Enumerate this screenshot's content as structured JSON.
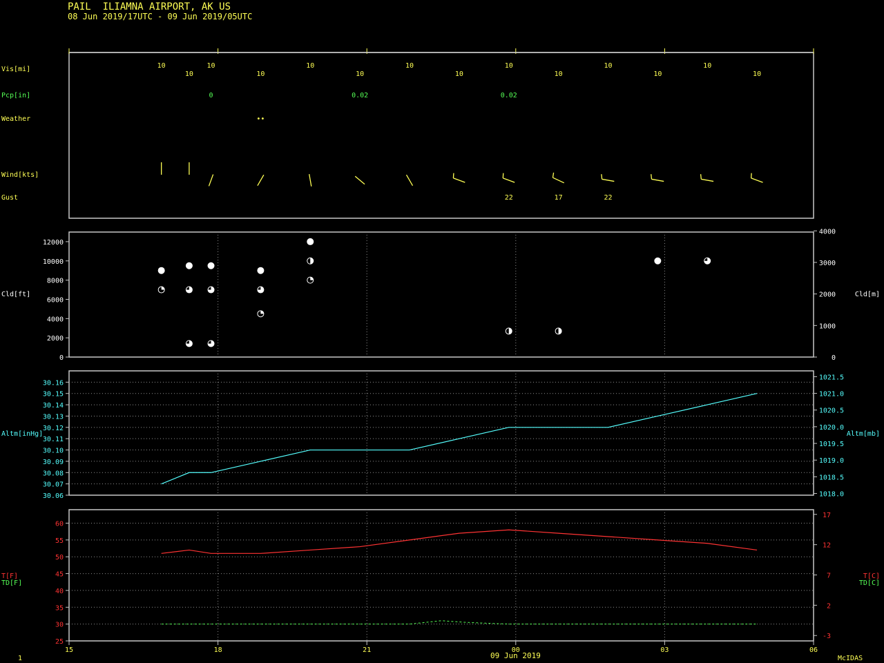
{
  "header": {
    "station": "PAIL",
    "station_name": "ILIAMNA AIRPORT, AK US",
    "period": "08 Jun 2019/17UTC - 09 Jun 2019/05UTC"
  },
  "footer": {
    "date_label": "09 Jun 2019",
    "page_number": "1",
    "software": "McIDAS"
  },
  "colors": {
    "yellow": "#ffff55",
    "green": "#55ff55",
    "cyan": "#55ffff",
    "red": "#ff3333",
    "white": "#ffffff",
    "frame": "#c8c8c8"
  },
  "chart_data": [
    {
      "type": "table",
      "panel": "surface-observations",
      "x_ticks": [
        "15",
        "18",
        "21",
        "00",
        "03",
        "06"
      ],
      "rows": {
        "vis": {
          "label": "Vis[mi]",
          "values": [
            {
              "x": 16.86,
              "v": "10"
            },
            {
              "x": 17.42,
              "v": "10"
            },
            {
              "x": 17.86,
              "v": "10"
            },
            {
              "x": 18.86,
              "v": "10"
            },
            {
              "x": 19.86,
              "v": "10"
            },
            {
              "x": 20.86,
              "v": "10"
            },
            {
              "x": 21.86,
              "v": "10"
            },
            {
              "x": 22.86,
              "v": "10"
            },
            {
              "x": 23.86,
              "v": "10"
            },
            {
              "x": 24.86,
              "v": "10"
            },
            {
              "x": 25.86,
              "v": "10"
            },
            {
              "x": 26.86,
              "v": "10"
            },
            {
              "x": 27.86,
              "v": "10"
            },
            {
              "x": 28.86,
              "v": "10"
            }
          ]
        },
        "pcp": {
          "label": "Pcp[in]",
          "values": [
            {
              "x": 17.86,
              "v": "0"
            },
            {
              "x": 20.86,
              "v": "0.02"
            },
            {
              "x": 23.86,
              "v": "0.02"
            }
          ]
        },
        "weather": {
          "label": "Weather",
          "values": [
            {
              "x": 18.86,
              "v": "••"
            }
          ]
        },
        "wind": {
          "label": "Wind[kts]",
          "barbs": [
            {
              "x": 16.86,
              "dir": 360,
              "speed": 0
            },
            {
              "x": 17.42,
              "dir": 360,
              "speed": 0
            },
            {
              "x": 17.86,
              "dir": 20,
              "speed": 2
            },
            {
              "x": 18.86,
              "dir": 30,
              "speed": 2
            },
            {
              "x": 19.86,
              "dir": 350,
              "speed": 2
            },
            {
              "x": 20.86,
              "dir": 310,
              "speed": 2
            },
            {
              "x": 21.86,
              "dir": 330,
              "speed": 2
            },
            {
              "x": 22.86,
              "dir": 290,
              "speed": 10
            },
            {
              "x": 23.86,
              "dir": 290,
              "speed": 10
            },
            {
              "x": 24.86,
              "dir": 295,
              "speed": 10
            },
            {
              "x": 25.86,
              "dir": 280,
              "speed": 10
            },
            {
              "x": 26.86,
              "dir": 280,
              "speed": 10
            },
            {
              "x": 27.86,
              "dir": 280,
              "speed": 10
            },
            {
              "x": 28.86,
              "dir": 290,
              "speed": 10
            }
          ]
        },
        "gust": {
          "label": "Gust",
          "values": [
            {
              "x": 23.86,
              "v": "22"
            },
            {
              "x": 24.86,
              "v": "17"
            },
            {
              "x": 25.86,
              "v": "22"
            }
          ]
        }
      }
    },
    {
      "type": "scatter",
      "panel": "cloud-layers",
      "ylabel_left": "Cld[ft]",
      "ylabel_right": "Cld[m]",
      "ylim": [
        0,
        13000
      ],
      "left_ticks": [
        0,
        2000,
        4000,
        6000,
        8000,
        10000,
        12000
      ],
      "right_ticks": [
        0,
        1000,
        2000,
        3000,
        4000
      ],
      "points": [
        {
          "x": 16.86,
          "y": 9000,
          "cover": "OVC"
        },
        {
          "x": 16.86,
          "y": 7000,
          "cover": "SCT"
        },
        {
          "x": 17.42,
          "y": 9500,
          "cover": "OVC"
        },
        {
          "x": 17.42,
          "y": 7000,
          "cover": "BKN"
        },
        {
          "x": 17.42,
          "y": 1400,
          "cover": "BKN"
        },
        {
          "x": 17.86,
          "y": 9500,
          "cover": "OVC"
        },
        {
          "x": 17.86,
          "y": 7000,
          "cover": "BKN"
        },
        {
          "x": 17.86,
          "y": 1400,
          "cover": "BKN"
        },
        {
          "x": 18.86,
          "y": 9000,
          "cover": "OVC"
        },
        {
          "x": 18.86,
          "y": 7000,
          "cover": "BKN"
        },
        {
          "x": 18.86,
          "y": 4500,
          "cover": "SCT"
        },
        {
          "x": 19.86,
          "y": 12000,
          "cover": "OVC"
        },
        {
          "x": 19.86,
          "y": 10000,
          "cover": "SCT2"
        },
        {
          "x": 19.86,
          "y": 8000,
          "cover": "SCT"
        },
        {
          "x": 23.86,
          "y": 2700,
          "cover": "SCT2"
        },
        {
          "x": 24.86,
          "y": 2700,
          "cover": "SCT2"
        },
        {
          "x": 26.86,
          "y": 10000,
          "cover": "OVC"
        },
        {
          "x": 27.86,
          "y": 10000,
          "cover": "BKN"
        }
      ]
    },
    {
      "type": "line",
      "panel": "altimeter",
      "ylabel_left": "Altm[inHg]",
      "ylabel_right": "Altm[mb]",
      "ylim": [
        30.06,
        30.17
      ],
      "left_ticks": [
        "30.06",
        "30.07",
        "30.08",
        "30.09",
        "30.10",
        "30.11",
        "30.12",
        "30.13",
        "30.14",
        "30.15",
        "30.16"
      ],
      "right_ticks": [
        "1018.0",
        "1018.5",
        "1019.0",
        "1019.5",
        "1020.0",
        "1020.5",
        "1021.0",
        "1021.5"
      ],
      "series": [
        {
          "x": [
            16.86,
            17.42,
            17.86,
            18.86,
            19.86,
            20.86,
            21.86,
            22.86,
            23.86,
            24.86,
            25.86,
            26.86,
            27.86,
            28.86
          ],
          "y": [
            30.07,
            30.08,
            30.08,
            30.09,
            30.1,
            30.1,
            30.1,
            30.11,
            30.12,
            30.12,
            30.12,
            30.13,
            30.14,
            30.15
          ]
        }
      ]
    },
    {
      "type": "line",
      "panel": "temperature",
      "ylabel_left_t": "T[F]",
      "ylabel_left_td": "TD[F]",
      "ylabel_right_t": "T[C]",
      "ylabel_right_td": "TD[C]",
      "ylim": [
        25,
        64
      ],
      "left_ticks": [
        25,
        30,
        35,
        40,
        45,
        50,
        55,
        60
      ],
      "right_ticks": [
        "-3",
        "2",
        "7",
        "12",
        "17"
      ],
      "x_label": "09 Jun 2019",
      "series": [
        {
          "name": "T",
          "x": [
            16.86,
            17.42,
            17.86,
            18.86,
            19.86,
            20.86,
            21.86,
            22.86,
            23.86,
            24.86,
            25.86,
            26.86,
            27.86,
            28.86
          ],
          "y": [
            51,
            52,
            51,
            51,
            52,
            53,
            55,
            57,
            58,
            57,
            56,
            55,
            54,
            52
          ]
        },
        {
          "name": "TD",
          "x": [
            16.86,
            17.42,
            17.86,
            18.86,
            19.86,
            20.86,
            21.86,
            22.5,
            23.0,
            23.86,
            24.86,
            25.86,
            26.86,
            27.86,
            28.86
          ],
          "y": [
            30,
            30,
            30,
            30,
            30,
            30,
            30,
            31,
            30.5,
            30,
            30,
            30,
            30,
            30,
            30
          ]
        }
      ]
    }
  ]
}
